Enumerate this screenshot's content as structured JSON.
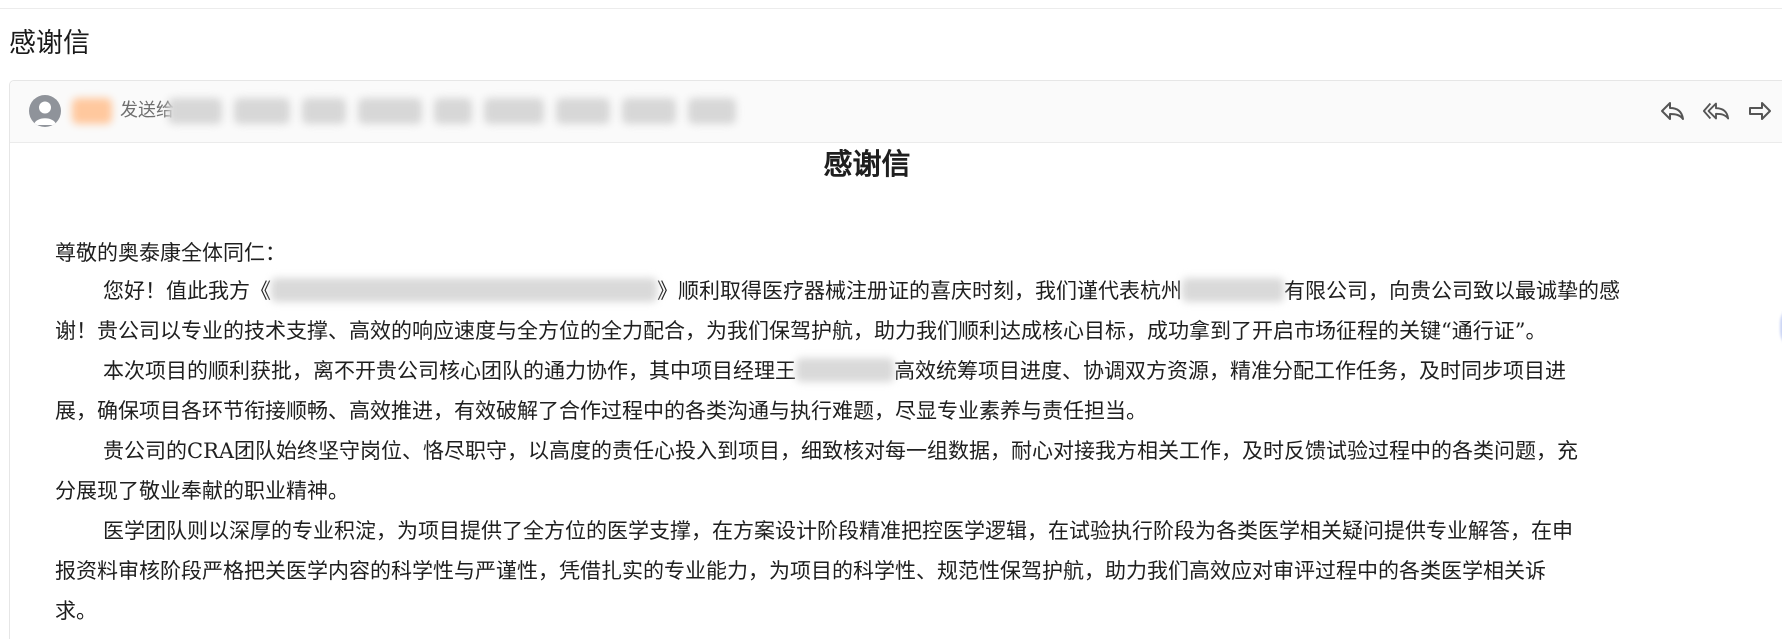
{
  "page": {
    "title": "感谢信"
  },
  "header": {
    "send_to_label": "发送给",
    "sender_color": "#ffc89e",
    "icons": [
      "avatar-icon",
      "reply-icon",
      "reply-all-icon",
      "forward-icon",
      "star-icon"
    ]
  },
  "letter": {
    "title": "感谢信",
    "salutation": "尊敬的奥泰康全体同仁：",
    "p1": {
      "l1_a": "您好！值此我方《",
      "l1_b": "》顺利取得医疗器械注册证的喜庆时刻，我们谨代表杭州",
      "l1_c": "有限公司，向贵公司致以最诚挚的感",
      "l2": "谢！贵公司以专业的技术支撑、高效的响应速度与全方位的全力配合，为我们保驾护航，助力我们顺利达成核心目标，成功拿到了开启市场征程的关键“通行证”。"
    },
    "p2": {
      "l1_a": "本次项目的顺利获批，离不开贵公司核心团队的通力协作，其中项目经理王",
      "l1_b": "高效统筹项目进度、协调双方资源，精准分配工作任务，及时同步项目进",
      "l2": "展，确保项目各环节衔接顺畅、高效推进，有效破解了合作过程中的各类沟通与执行难题，尽显专业素养与责任担当。"
    },
    "p3": {
      "l1": "贵公司的CRA团队始终坚守岗位、恪尽职守，以高度的责任心投入到项目，细致核对每一组数据，耐心对接我方相关工作，及时反馈试验过程中的各类问题，充",
      "l2": "分展现了敬业奉献的职业精神。"
    },
    "p4": {
      "l1": "医学团队则以深厚的专业积淀，为项目提供了全方位的医学支撑，在方案设计阶段精准把控医学逻辑，在试验执行阶段为各类医学相关疑问提供专业解答，在申",
      "l2": "报资料审核阶段严格把关医学内容的科学性与严谨性，凭借扎实的专业能力，为项目的科学性、规范性保驾护航，助力我们高效应对审评过程中的各类医学相关诉",
      "l3": "求。"
    }
  }
}
